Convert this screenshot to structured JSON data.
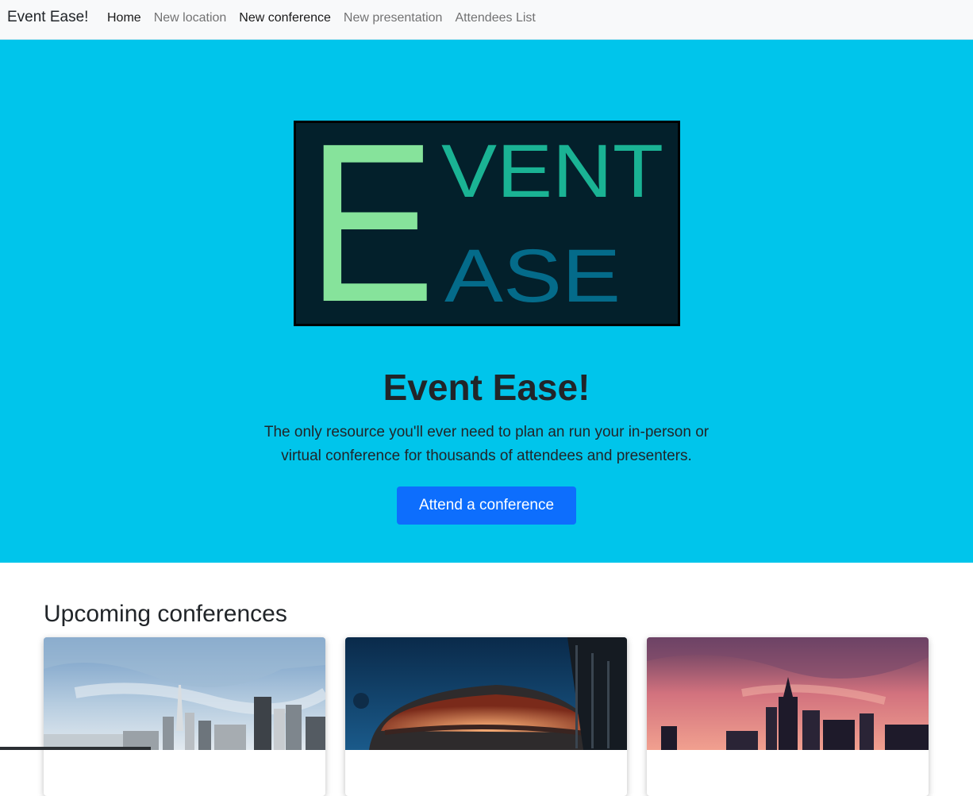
{
  "navbar": {
    "brand": "Event Ease!",
    "links": [
      {
        "label": "Home",
        "active": true
      },
      {
        "label": "New location",
        "active": false
      },
      {
        "label": "New conference",
        "active": true
      },
      {
        "label": "New presentation",
        "active": false
      },
      {
        "label": "Attendees List",
        "active": false
      }
    ]
  },
  "hero": {
    "logo": {
      "letter_e": "E",
      "line1": "VENT",
      "line2": "ASE"
    },
    "title": "Event Ease!",
    "lead": "The only resource you'll ever need to plan an run your in-person or virtual conference for thousands of attendees and presenters.",
    "button_label": "Attend a conference",
    "background_color": "#00c5eb"
  },
  "section": {
    "title": "Upcoming conferences",
    "cards": [
      {
        "image": "city-skyline-day-photo"
      },
      {
        "image": "arena-at-night-photo"
      },
      {
        "image": "city-skyline-sunset-photo"
      }
    ]
  },
  "colors": {
    "accent": "#0d6efd",
    "logo_green": "#86e39b",
    "logo_teal": "#1ab394",
    "logo_blue": "#046b8a",
    "logo_bg": "#03202b"
  }
}
